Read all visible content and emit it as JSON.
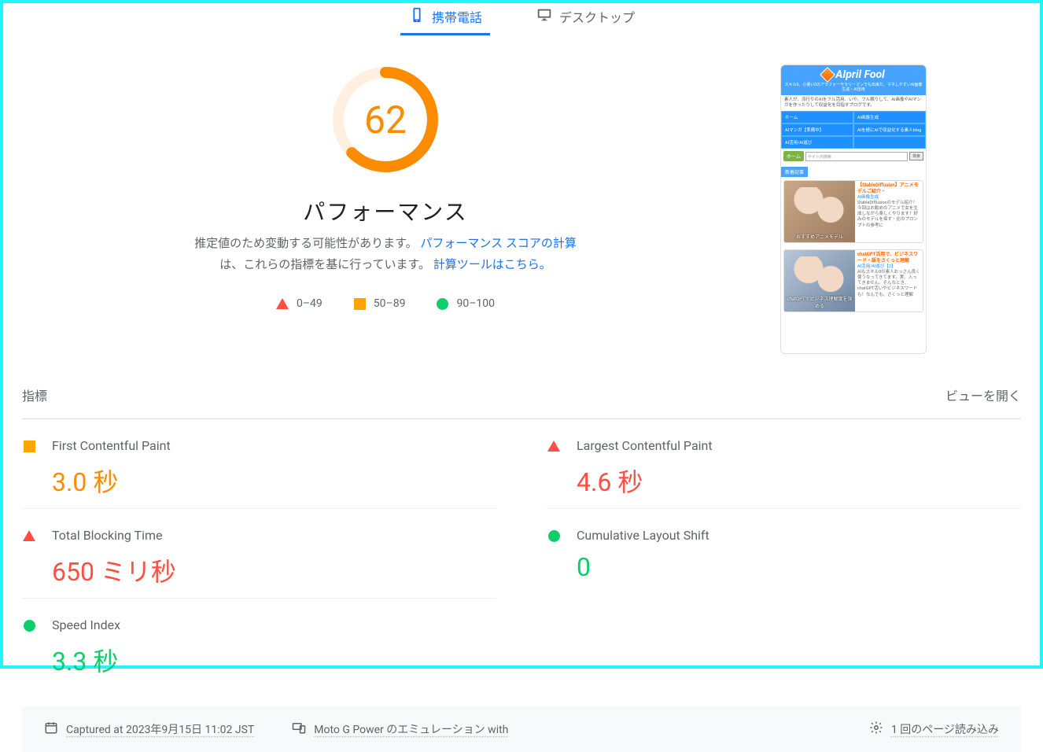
{
  "tabs": {
    "mobile": "携帯電話",
    "desktop": "デスクトップ"
  },
  "score": {
    "value": "62",
    "color": "#fb8c00",
    "percent": 62,
    "title": "パフォーマンス",
    "desc_prefix": "推定値のため変動する可能性があります。",
    "link1": "パフォーマンス スコアの計算",
    "desc_mid": "は、これらの指標を基に行っています。",
    "link2": "計算ツールはこちら。"
  },
  "legend": {
    "low": "0–49",
    "mid": "50–89",
    "high": "90–100"
  },
  "section": {
    "heading": "指標",
    "toggle": "ビューを開く"
  },
  "metrics": [
    {
      "icon": "square",
      "label": "First Contentful Paint",
      "value": "3.0 秒",
      "cls": "val-orange"
    },
    {
      "icon": "triangle",
      "label": "Largest Contentful Paint",
      "value": "4.6 秒",
      "cls": "val-red"
    },
    {
      "icon": "triangle",
      "label": "Total Blocking Time",
      "value": "650 ミリ秒",
      "cls": "val-red"
    },
    {
      "icon": "circle",
      "label": "Cumulative Layout Shift",
      "value": "0",
      "cls": "val-green"
    },
    {
      "icon": "circle",
      "label": "Speed Index",
      "value": "3.3 秒",
      "cls": "val-green"
    }
  ],
  "footer": {
    "captured_at": "Captured at 2023年9月15日 11:02 JST",
    "device": "Moto G Power のエミュレーション with",
    "loads": "1 回のページ読み込み"
  },
  "thumb": {
    "logo": "AIpril Fool",
    "tagline": "スキル0、小遣い0のアラフォーサラリーマンでも出来た、マネしやすいAI画像生成・AI活用",
    "subtitle": "素人が、流行りのAIをフル活用、いや、フル頼りして、AI画像やAIマンガを作ったりして収益化を目指すブログです。",
    "nav": [
      "ホーム",
      "AI画像生成",
      "AIマンガ【準備中】",
      "AIを極にAIで収益化する素人blog",
      "AI活用/AI遊び",
      ""
    ],
    "home_btn": "ホーム",
    "search_placeholder": "サイト内検索",
    "search_btn": "検索",
    "section_tab": "新着記事",
    "card1": {
      "overlay": "おすすめアニメモデル",
      "title": "【StableDiffusion】アニメモデルご紹介・",
      "cat": "AI画像生成",
      "body": "StableDiffusionのモデル紹介！今回はお勧めのアニメで女を生成しながら楽しくやります！好みのモデルを探す・比のプロンプトの参考に"
    },
    "card2": {
      "overlay": "chatGPTでビジネス理解度を深める",
      "title": "chatGPT活用で、ビジネスワード・語をさくっと理解",
      "cat": "AI活用/AI遊び【2】",
      "body": "AIもスキル0の素人おっさん良く使うなってきてます。実、入ってきません。そんなとき、chatGPT活いやビジネスワードも！なんでも、さくっと理解"
    }
  }
}
